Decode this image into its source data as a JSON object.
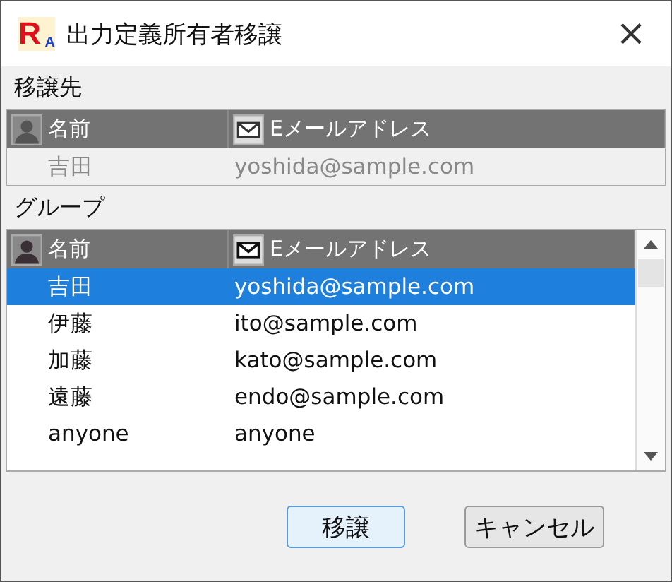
{
  "window": {
    "title": "出力定義所有者移譲",
    "logo": {
      "main": "R",
      "sub": "A"
    },
    "close": "×"
  },
  "recipient": {
    "label": "移譲先",
    "columns": [
      "名前",
      "Eメールアドレス"
    ],
    "disabled": true,
    "rows": [
      {
        "name": "吉田",
        "email": "yoshida@sample.com"
      }
    ]
  },
  "group": {
    "label": "グループ",
    "columns": [
      "名前",
      "Eメールアドレス"
    ],
    "rows": [
      {
        "name": "吉田",
        "email": "yoshida@sample.com",
        "selected": true
      },
      {
        "name": "伊藤",
        "email": "ito@sample.com",
        "selected": false
      },
      {
        "name": "加藤",
        "email": "kato@sample.com",
        "selected": false
      },
      {
        "name": "遠藤",
        "email": "endo@sample.com",
        "selected": false
      },
      {
        "name": "anyone",
        "email": "anyone",
        "selected": false
      }
    ]
  },
  "buttons": [
    {
      "label": "移譲",
      "kind": "primary"
    },
    {
      "label": "キャンセル",
      "kind": "normal"
    }
  ]
}
